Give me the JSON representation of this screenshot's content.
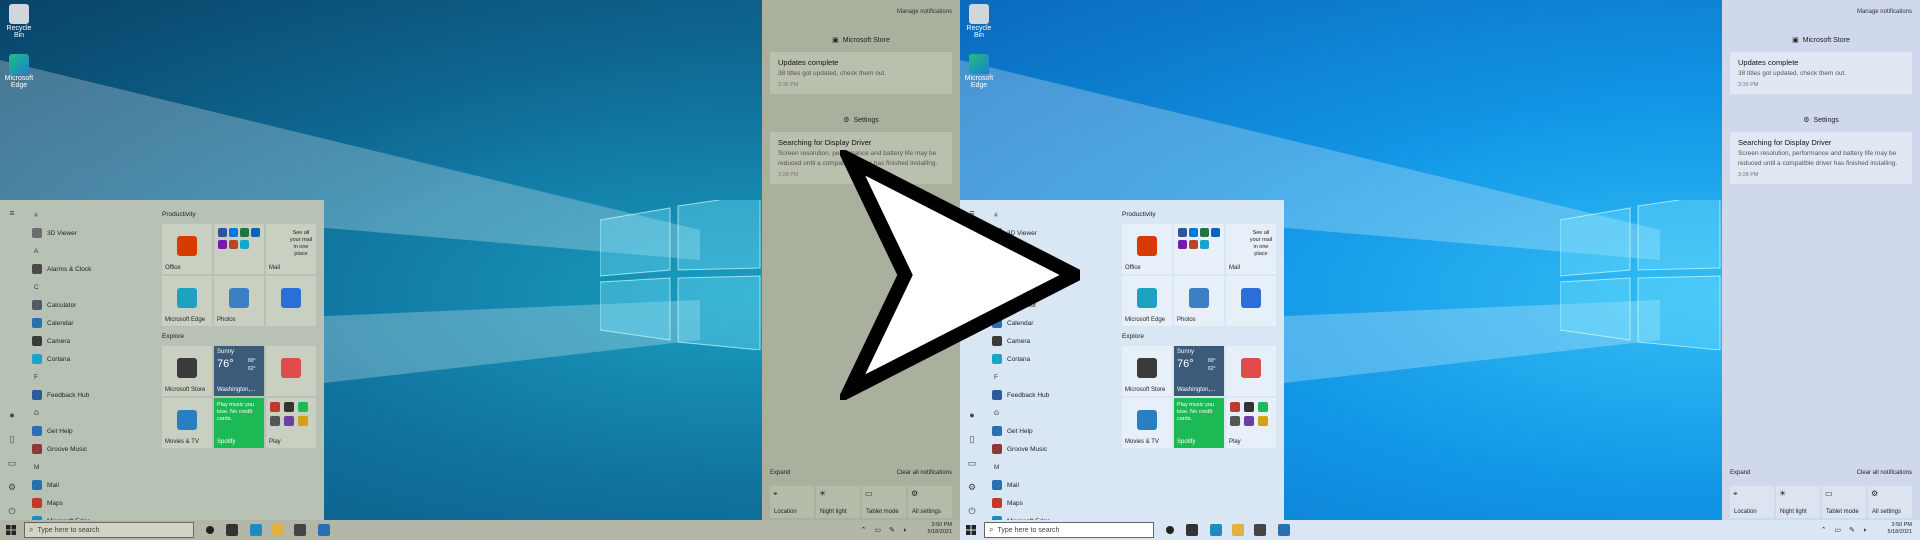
{
  "desktop": {
    "icons": [
      {
        "label": "Recycle Bin",
        "icon": "recycle-bin-icon"
      },
      {
        "label": "Microsoft Edge",
        "icon": "edge-icon"
      }
    ]
  },
  "start_menu": {
    "app_list": [
      {
        "type": "letter",
        "label": "#"
      },
      {
        "type": "app",
        "label": "3D Viewer",
        "color": "#6c6c6c"
      },
      {
        "type": "letter",
        "label": "A"
      },
      {
        "type": "app",
        "label": "Alarms & Clock",
        "color": "#4a4a4a"
      },
      {
        "type": "letter",
        "label": "C"
      },
      {
        "type": "app",
        "label": "Calculator",
        "color": "#505a60"
      },
      {
        "type": "app",
        "label": "Calendar",
        "color": "#2a6fb0"
      },
      {
        "type": "app",
        "label": "Camera",
        "color": "#3a3a3a"
      },
      {
        "type": "app",
        "label": "Cortana",
        "color": "#1aa5c8"
      },
      {
        "type": "letter",
        "label": "F"
      },
      {
        "type": "app",
        "label": "Feedback Hub",
        "color": "#2b5b9c"
      },
      {
        "type": "letter",
        "label": "G"
      },
      {
        "type": "app",
        "label": "Get Help",
        "color": "#2a6fb0"
      },
      {
        "type": "app",
        "label": "Groove Music",
        "color": "#8a3a3a"
      },
      {
        "type": "letter",
        "label": "M"
      },
      {
        "type": "app",
        "label": "Mail",
        "color": "#2a6fb0"
      },
      {
        "type": "app",
        "label": "Maps",
        "color": "#c0392b"
      },
      {
        "type": "app",
        "label": "Microsoft Edge",
        "color": "#1e8cc0"
      }
    ],
    "groups": {
      "productivity": "Productivity",
      "explore": "Explore"
    },
    "tiles": {
      "office": "Office",
      "mail_promo": "See all your mail in one place",
      "mail": "Mail",
      "edge": "Microsoft Edge",
      "photos": "Photos",
      "store": "Microsoft Store",
      "weather_cond": "Sunny",
      "weather_temp": "76°",
      "weather_hi": "80°",
      "weather_lo": "62°",
      "weather_city": "Washington,...",
      "movies": "Movies & TV",
      "spotify_promo": "Play music you love. No credit cards.",
      "spotify": "Spotify",
      "play": "Play"
    }
  },
  "action_center": {
    "manage": "Manage notifications",
    "groups": [
      {
        "source": "Microsoft Store",
        "title": "Updates complete",
        "body": "38 titles got updated, check them out.",
        "time": "3:35 PM"
      },
      {
        "source": "Settings",
        "title": "Searching for Display Driver",
        "body": "Screen resolution, performance and battery life may be reduced until a compatible driver has finished installing.",
        "time": "3:28 PM"
      }
    ],
    "expand": "Expand",
    "clear_all": "Clear all notifications",
    "quick_actions": [
      {
        "label": "Location",
        "icon": "location-icon"
      },
      {
        "label": "Night light",
        "icon": "night-light-icon"
      },
      {
        "label": "Tablet mode",
        "icon": "tablet-mode-icon"
      },
      {
        "label": "All settings",
        "icon": "gear-icon"
      }
    ]
  },
  "taskbar": {
    "search_placeholder": "Type here to search",
    "time": "3:50 PM",
    "date": "5/18/2021"
  },
  "colors": {
    "old_theme_panel": "#b8c2b4",
    "new_theme_panel": "#d8e7f3",
    "new_wallpaper": "#1297e6"
  }
}
